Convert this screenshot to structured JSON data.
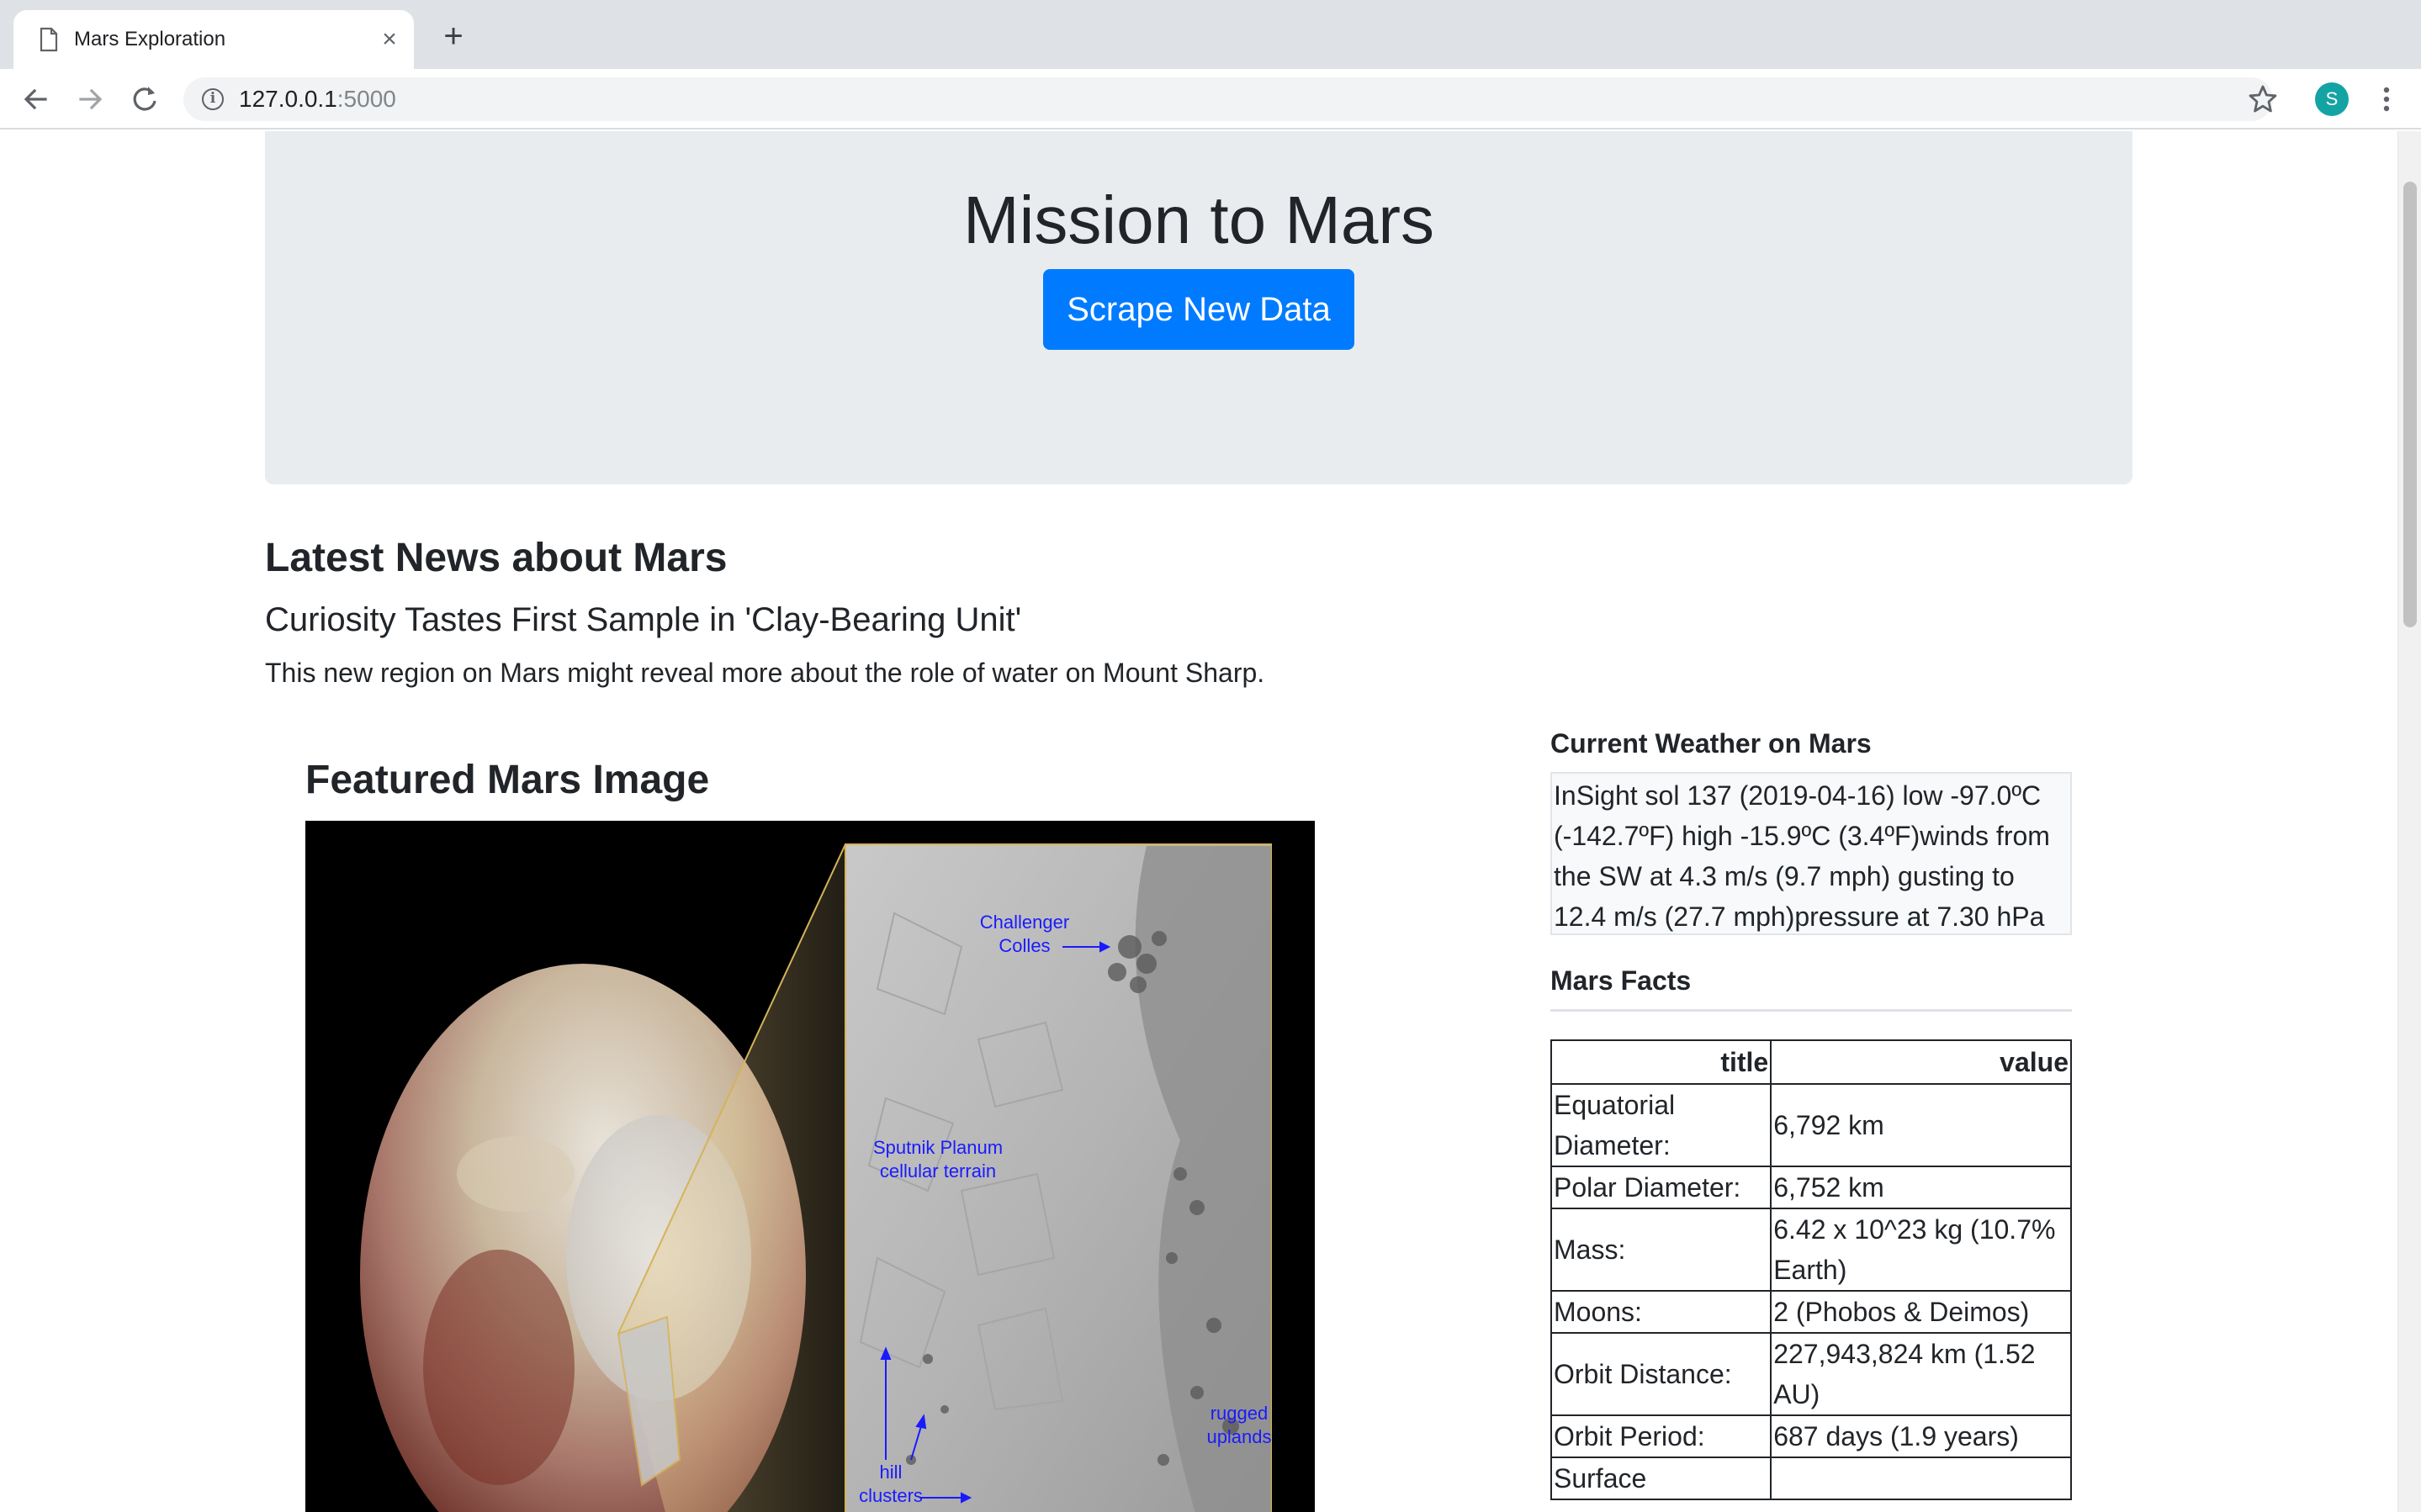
{
  "browser": {
    "tab_title": "Mars Exploration",
    "tab_close": "×",
    "new_tab": "+",
    "url_host": "127.0.0.1",
    "url_port": ":5000",
    "profile_initial": "S",
    "icons": [
      "page-icon",
      "back-icon",
      "forward-icon",
      "reload-icon",
      "info-icon",
      "star-icon",
      "kebab-menu-icon"
    ]
  },
  "jumbotron": {
    "title": "Mission to Mars",
    "button_label": "Scrape New Data"
  },
  "news": {
    "heading": "Latest News about Mars",
    "title": "Curiosity Tastes First Sample in 'Clay-Bearing Unit'",
    "paragraph": "This new region on Mars might reveal more about the role of water on Mount Sharp."
  },
  "featured": {
    "heading": "Featured Mars Image",
    "annotations": {
      "challenger": [
        "Challenger",
        "Colles"
      ],
      "sputnik": [
        "Sputnik Planum",
        "cellular terrain"
      ],
      "rugged": [
        "rugged",
        "uplands"
      ],
      "hill": [
        "hill",
        "clusters"
      ]
    }
  },
  "weather": {
    "heading": "Current Weather on Mars",
    "text": "InSight sol 137 (2019-04-16) low -97.0ºC (-142.7ºF) high -15.9ºC (3.4ºF)winds from the SW at 4.3 m/s (9.7 mph) gusting to 12.4 m/s (27.7 mph)pressure at 7.30 hPa"
  },
  "facts": {
    "heading": "Mars Facts",
    "columns": [
      "title",
      "value"
    ],
    "rows": [
      [
        "Equatorial Diameter:",
        "6,792 km"
      ],
      [
        "Polar Diameter:",
        "6,752 km"
      ],
      [
        "Mass:",
        "6.42 x 10^23 kg (10.7% Earth)"
      ],
      [
        "Moons:",
        "2 (Phobos & Deimos)"
      ],
      [
        "Orbit Distance:",
        "227,943,824 km (1.52 AU)"
      ],
      [
        "Orbit Period:",
        "687 days (1.9 years)"
      ],
      [
        "Surface",
        ""
      ]
    ]
  }
}
